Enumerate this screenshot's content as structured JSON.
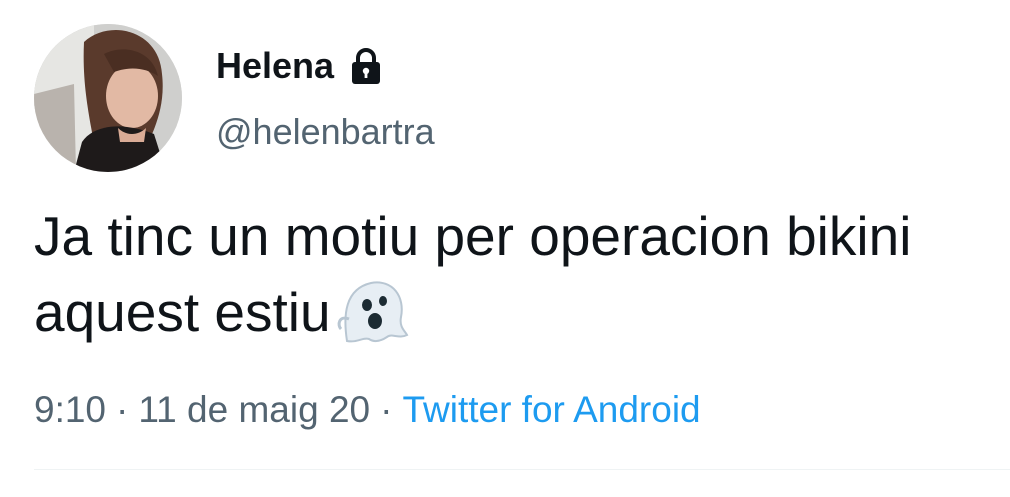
{
  "user": {
    "display_name": "Helena",
    "handle": "@helenbartra",
    "protected_icon": "lock-icon",
    "avatar": "profile-photo"
  },
  "tweet": {
    "text": "Ja tinc un motiu per operacion bikini aquest estiu",
    "emoji": "ghost-icon",
    "time": "9:10",
    "date": "11 de maig 20",
    "separator": "·",
    "source": "Twitter for Android"
  },
  "colors": {
    "text": "#0f1419",
    "secondary": "#536471",
    "link": "#1d9bf0"
  }
}
